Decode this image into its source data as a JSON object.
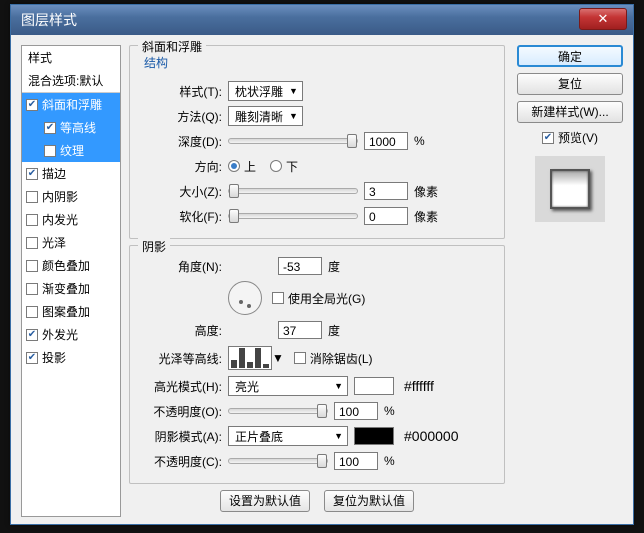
{
  "window": {
    "title": "图层样式"
  },
  "left_panel": {
    "header": "样式",
    "subheader": "混合选项:默认",
    "items": [
      {
        "label": "斜面和浮雕",
        "checked": true,
        "selected": true,
        "child": false
      },
      {
        "label": "等高线",
        "checked": true,
        "selected": true,
        "child": true
      },
      {
        "label": "纹理",
        "checked": false,
        "selected": true,
        "child": true
      },
      {
        "label": "描边",
        "checked": true,
        "selected": false,
        "child": false
      },
      {
        "label": "内阴影",
        "checked": false,
        "selected": false,
        "child": false
      },
      {
        "label": "内发光",
        "checked": false,
        "selected": false,
        "child": false
      },
      {
        "label": "光泽",
        "checked": false,
        "selected": false,
        "child": false
      },
      {
        "label": "颜色叠加",
        "checked": false,
        "selected": false,
        "child": false
      },
      {
        "label": "渐变叠加",
        "checked": false,
        "selected": false,
        "child": false
      },
      {
        "label": "图案叠加",
        "checked": false,
        "selected": false,
        "child": false
      },
      {
        "label": "外发光",
        "checked": true,
        "selected": false,
        "child": false
      },
      {
        "label": "投影",
        "checked": true,
        "selected": false,
        "child": false
      }
    ]
  },
  "main": {
    "title": "斜面和浮雕",
    "structure": {
      "legend": "结构",
      "style_label": "样式(T):",
      "style_value": "枕状浮雕",
      "tech_label": "方法(Q):",
      "tech_value": "雕刻清晰",
      "depth_label": "深度(D):",
      "depth_value": "1000",
      "depth_unit": "%",
      "direction_label": "方向:",
      "direction_up": "上",
      "direction_down": "下",
      "size_label": "大小(Z):",
      "size_value": "3",
      "size_unit": "像素",
      "soft_label": "软化(F):",
      "soft_value": "0",
      "soft_unit": "像素"
    },
    "shadow": {
      "legend": "阴影",
      "angle_label": "角度(N):",
      "angle_value": "-53",
      "angle_unit": "度",
      "global_label": "使用全局光(G)",
      "global_checked": false,
      "alt_label": "高度:",
      "alt_value": "37",
      "alt_unit": "度",
      "gloss_label": "光泽等高线:",
      "aa_label": "消除锯齿(L)",
      "aa_checked": false,
      "hi_mode_label": "高光模式(H):",
      "hi_mode_value": "亮光",
      "hi_swatch": "#ffffff",
      "hi_hex": "#ffffff",
      "hi_op_label": "不透明度(O):",
      "hi_op_value": "100",
      "hi_op_unit": "%",
      "sh_mode_label": "阴影模式(A):",
      "sh_mode_value": "正片叠底",
      "sh_swatch": "#000000",
      "sh_hex": "#000000",
      "sh_op_label": "不透明度(C):",
      "sh_op_value": "100",
      "sh_op_unit": "%"
    },
    "defaults": {
      "make": "设置为默认值",
      "reset": "复位为默认值"
    }
  },
  "right": {
    "ok": "确定",
    "reset_btn": "复位",
    "new_style": "新建样式(W)...",
    "preview_label": "预览(V)",
    "preview_checked": true
  }
}
